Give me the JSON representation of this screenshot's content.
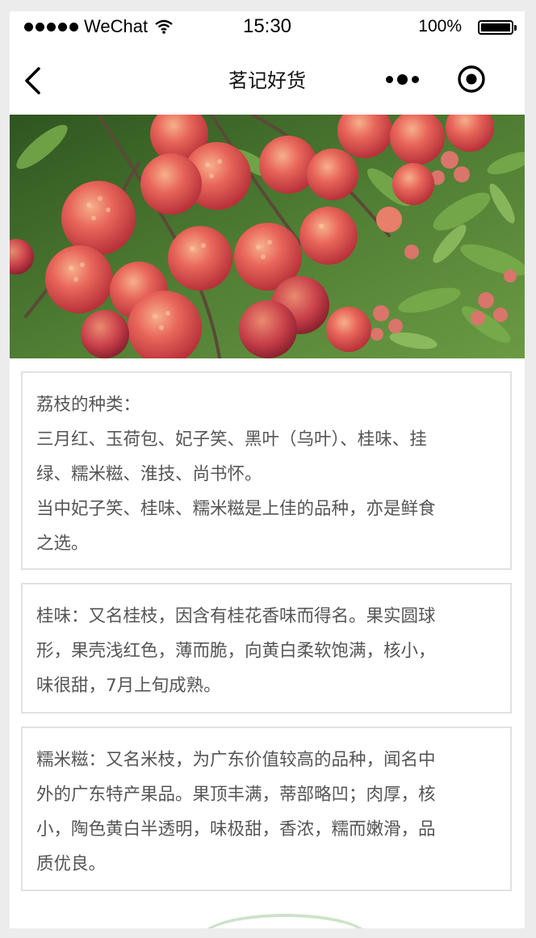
{
  "status_bar": {
    "carrier": "WeChat",
    "time": "15:30",
    "battery": "100%"
  },
  "nav": {
    "title": "茗记好货"
  },
  "hero_image": {
    "subject": "lychee-fruit-photo"
  },
  "cards": [
    {
      "lines": [
        "荔枝的种类：",
        "三月红、玉荷包、妃子笑、黑叶（乌叶）、桂味、挂",
        "绿、糯米糍、淮技、尚书怀。",
        "当中妃子笑、桂味、糯米糍是上佳的品种，亦是鲜食",
        "之选。"
      ]
    },
    {
      "lines": [
        "桂味：又名桂枝，因含有桂花香味而得名。果实圆球",
        "形，果壳浅红色，薄而脆，向黄白柔软饱满，核小，",
        "味很甜，7月上旬成熟。"
      ]
    },
    {
      "lines": [
        "糯米糍：又名米枝，为广东价值较高的品种，闻名中",
        "外的广东特产果品。果顶丰满，蒂部略凹；肉厚，核",
        "小，陶色黄白半透明，味极甜，香浓，糯而嫩滑，品",
        "质优良。"
      ]
    }
  ],
  "colors": {
    "background": "#ececec",
    "card_border": "#e1e1e1",
    "body_text": "#555555"
  }
}
